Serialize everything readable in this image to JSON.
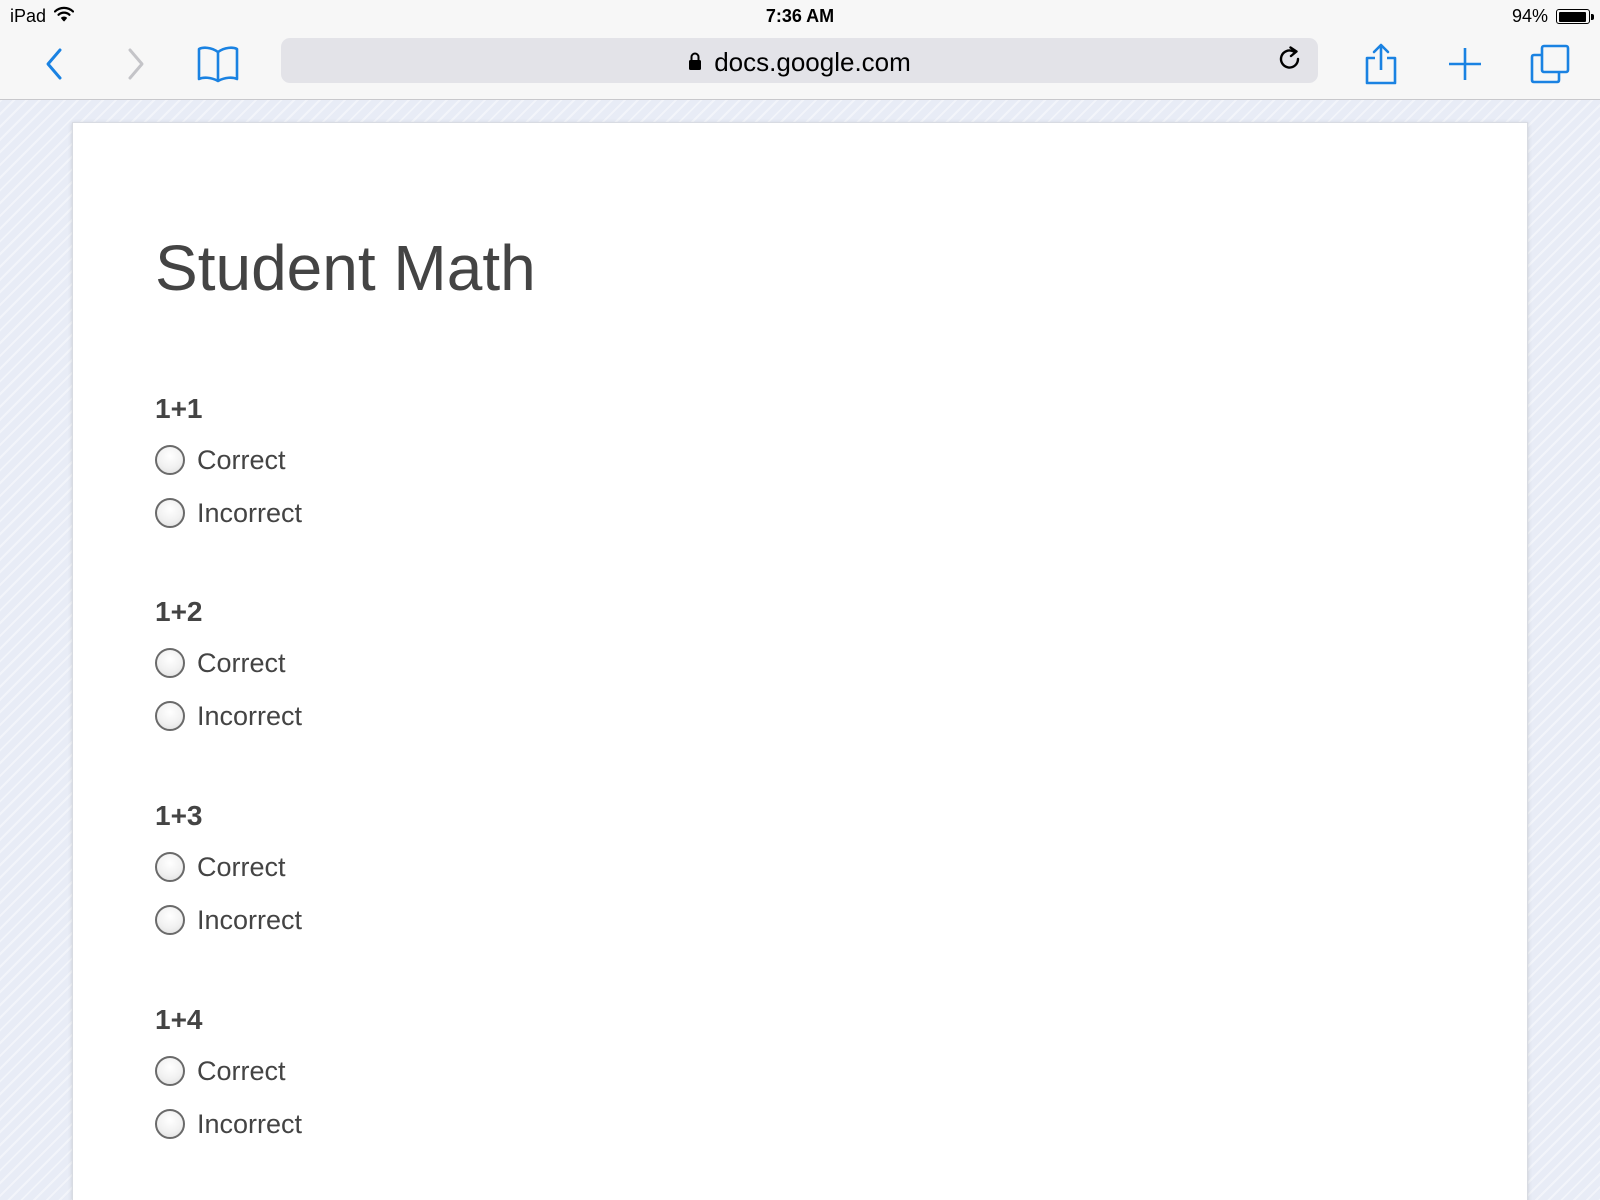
{
  "status_bar": {
    "device": "iPad",
    "time": "7:36 AM",
    "battery_percent": "94%",
    "battery_level": 0.94,
    "icons": [
      "wifi-icon",
      "battery-icon"
    ]
  },
  "browser": {
    "url": "docs.google.com",
    "icons": [
      "back-icon",
      "forward-icon",
      "bookmarks-icon",
      "lock-icon",
      "reload-icon",
      "share-icon",
      "new-tab-icon",
      "tabs-icon"
    ],
    "accent_color": "#1a82e2"
  },
  "form": {
    "title": "Student Math",
    "questions": [
      {
        "label": "1+1",
        "options": [
          "Correct",
          "Incorrect"
        ]
      },
      {
        "label": "1+2",
        "options": [
          "Correct",
          "Incorrect"
        ]
      },
      {
        "label": "1+3",
        "options": [
          "Correct",
          "Incorrect"
        ]
      },
      {
        "label": "1+4",
        "options": [
          "Correct",
          "Incorrect"
        ]
      }
    ]
  }
}
